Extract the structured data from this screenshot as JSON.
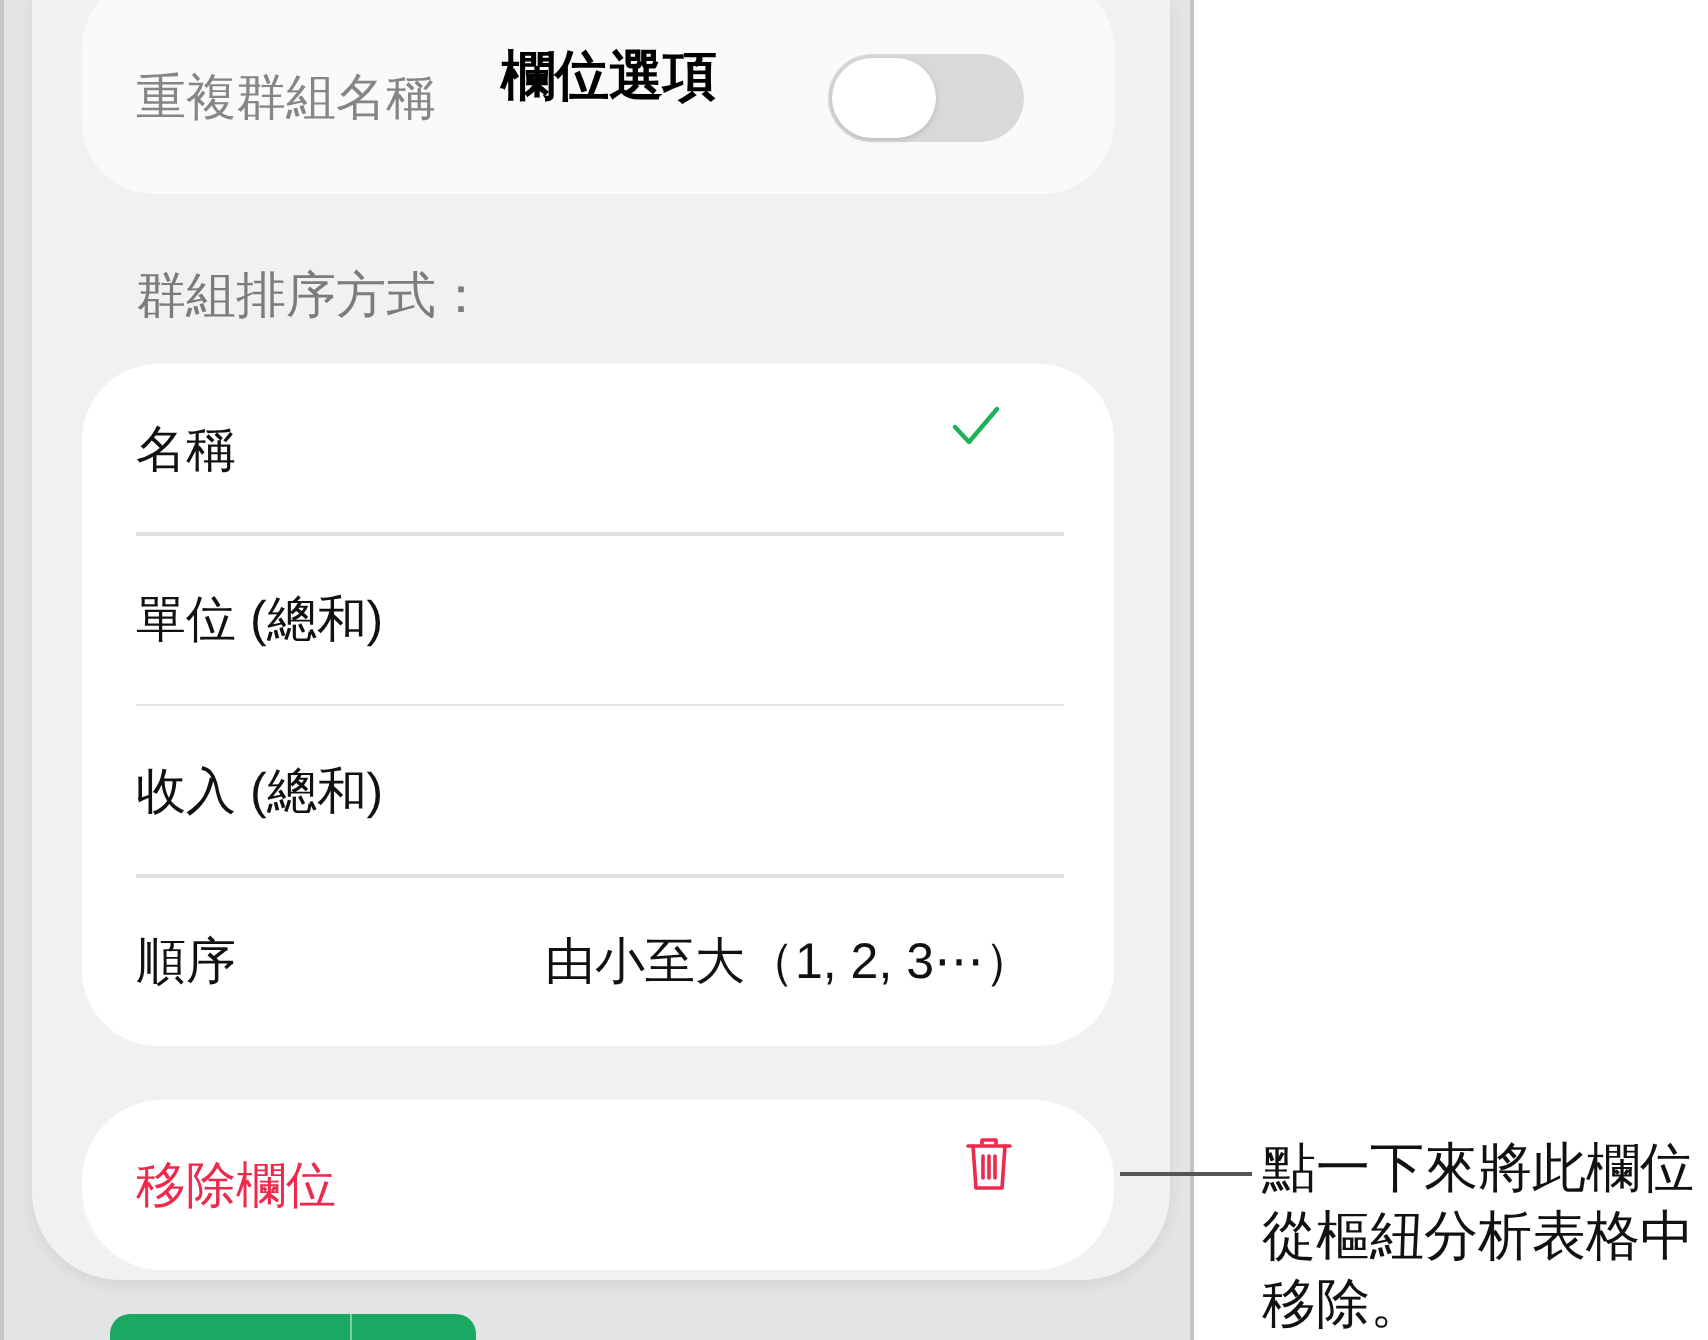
{
  "background_row": {
    "label": "重複群組名稱",
    "on": false
  },
  "title": "欄位選項",
  "sort_section": {
    "label": "群組排序方式：",
    "options": [
      {
        "label": "名稱",
        "selected": true
      },
      {
        "label": "單位 (總和)",
        "selected": false
      },
      {
        "label": "收入 (總和)",
        "selected": false
      }
    ],
    "order": {
      "label": "順序",
      "value": "由小至大（1, 2, 3⋯）"
    }
  },
  "remove": {
    "label": "移除欄位"
  },
  "callout": "點一下來將此欄位從樞紐分析表格中移除。"
}
